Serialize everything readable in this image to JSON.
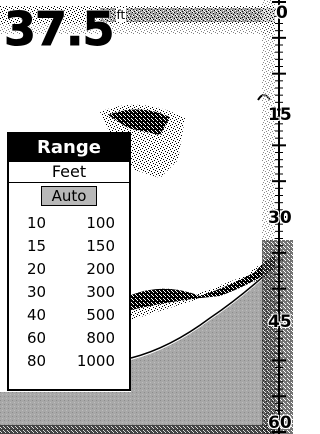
{
  "depth": {
    "value": "37.5",
    "unit": "ft"
  },
  "depth_scale": {
    "labels": [
      "0",
      "15",
      "30",
      "45",
      "60"
    ]
  },
  "range_menu": {
    "title": "Range",
    "units": "Feet",
    "selected": "Auto",
    "options": [
      {
        "low": "10",
        "high": "100"
      },
      {
        "low": "15",
        "high": "150"
      },
      {
        "low": "20",
        "high": "200"
      },
      {
        "low": "30",
        "high": "300"
      },
      {
        "low": "40",
        "high": "500"
      },
      {
        "low": "60",
        "high": "800"
      },
      {
        "low": "80",
        "high": "1000"
      }
    ]
  }
}
